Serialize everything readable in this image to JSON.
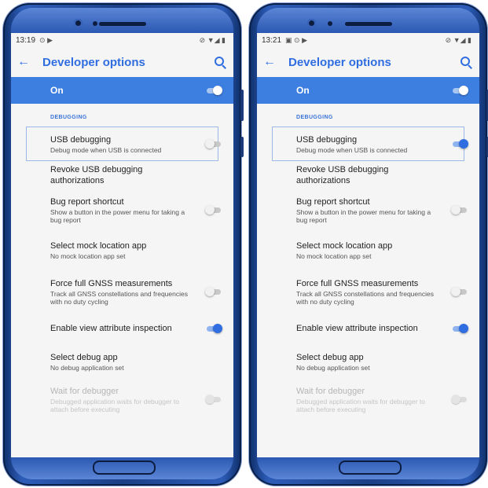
{
  "phones": [
    {
      "status": {
        "time": "13:19",
        "glyphs": "⊙ ▶",
        "right": "⊘ ▼◢ ▮"
      },
      "toolbar": {
        "title": "Developer options",
        "back_icon": "arrow-left-icon",
        "search_icon": "search-icon"
      },
      "master": {
        "label": "On",
        "on": true
      },
      "section": "DEBUGGING",
      "items": [
        {
          "title": "USB debugging",
          "summary": "Debug mode when USB is connected",
          "switch": "off",
          "selected": true
        },
        {
          "title": "Revoke USB debugging authorizations",
          "summary": ""
        },
        {
          "title": "Bug report shortcut",
          "summary": "Show a button in the power menu for taking a bug report",
          "switch": "off"
        },
        {
          "title": "Select mock location app",
          "summary": "No mock location app set"
        },
        {
          "title": "Force full GNSS measurements",
          "summary": "Track all GNSS constellations and frequencies with no duty cycling",
          "switch": "off"
        },
        {
          "title": "Enable view attribute inspection",
          "summary": "",
          "switch": "on"
        },
        {
          "title": "Select debug app",
          "summary": "No debug application set"
        },
        {
          "title": "Wait for debugger",
          "summary": "Debugged application waits for debugger to attach before executing",
          "switch": "disabled"
        }
      ]
    },
    {
      "status": {
        "time": "13:21",
        "glyphs": "▣ ⊙ ▶",
        "right": "⊘ ▼◢ ▮"
      },
      "toolbar": {
        "title": "Developer options",
        "back_icon": "arrow-left-icon",
        "search_icon": "search-icon"
      },
      "master": {
        "label": "On",
        "on": true
      },
      "section": "DEBUGGING",
      "items": [
        {
          "title": "USB debugging",
          "summary": "Debug mode when USB is connected",
          "switch": "on",
          "selected": true
        },
        {
          "title": "Revoke USB debugging authorizations",
          "summary": ""
        },
        {
          "title": "Bug report shortcut",
          "summary": "Show a button in the power menu for taking a bug report",
          "switch": "off"
        },
        {
          "title": "Select mock location app",
          "summary": "No mock location app set"
        },
        {
          "title": "Force full GNSS measurements",
          "summary": "Track all GNSS constellations and frequencies with no duty cycling",
          "switch": "off"
        },
        {
          "title": "Enable view attribute inspection",
          "summary": "",
          "switch": "on"
        },
        {
          "title": "Select debug app",
          "summary": "No debug application set"
        },
        {
          "title": "Wait for debugger",
          "summary": "Debugged application waits for debugger to attach before executing",
          "switch": "disabled"
        }
      ]
    }
  ],
  "colors": {
    "accent": "#2f6de0",
    "master_bar": "#3d7fe0",
    "device_body": "#1b3f86"
  }
}
